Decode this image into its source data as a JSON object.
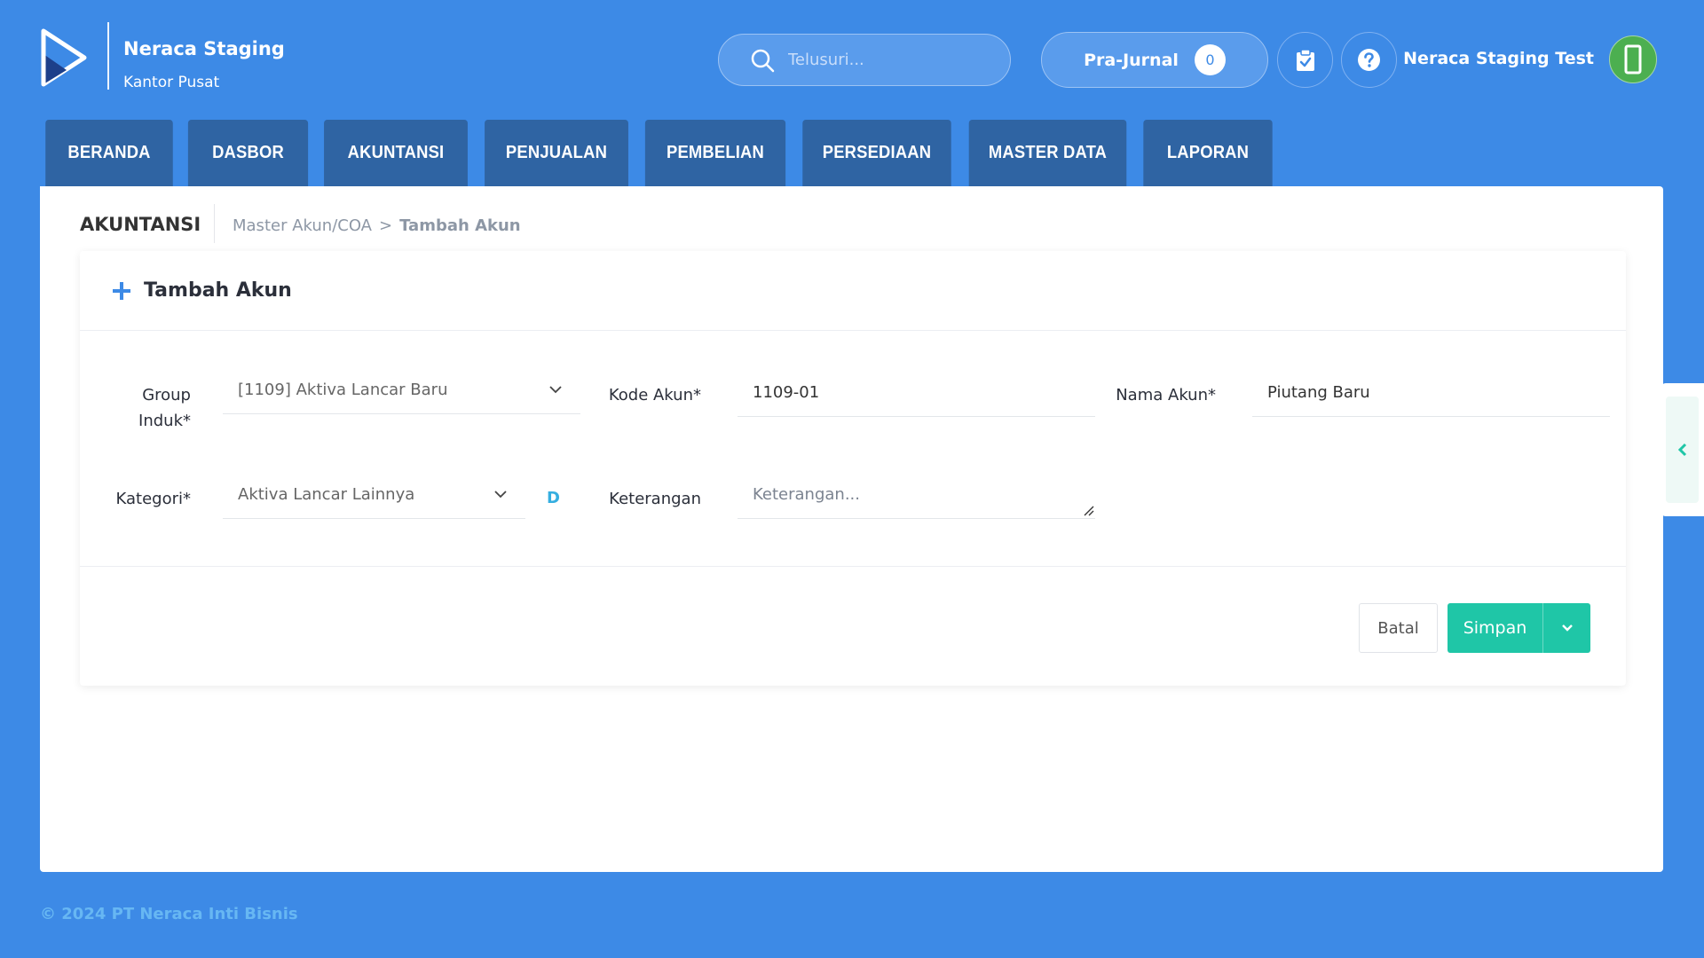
{
  "brand": {
    "name": "Neraca Staging",
    "office": "Kantor Pusat",
    "logo_icon": "play-logo-icon"
  },
  "header": {
    "search_placeholder": "Telusuri...",
    "prajurnal_label": "Pra-Jurnal",
    "prajurnal_count": "0",
    "user_name": "Neraca Staging Test",
    "icons": [
      "search-icon",
      "clipboard-check-icon",
      "help-icon",
      "phone-icon"
    ]
  },
  "nav": {
    "tabs": [
      "BERANDA",
      "DASBOR",
      "AKUNTANSI",
      "PENJUALAN",
      "PEMBELIAN",
      "PERSEDIAAN",
      "MASTER DATA",
      "LAPORAN"
    ]
  },
  "breadcrumb": {
    "section": "AKUNTANSI",
    "parent": "Master Akun/COA",
    "separator": ">",
    "current": "Tambah Akun"
  },
  "form": {
    "title": "Tambah Akun",
    "group_induk_label_1": "Group",
    "group_induk_label_2": "Induk*",
    "group_induk_value": "[1109] Aktiva Lancar Baru",
    "kode_akun_label": "Kode Akun*",
    "kode_akun_value": "1109-01",
    "nama_akun_label": "Nama Akun*",
    "nama_akun_value": "Piutang Baru",
    "kategori_label": "Kategori*",
    "kategori_value": "Aktiva Lancar Lainnya",
    "kategori_badge": "D",
    "keterangan_label": "Keterangan",
    "keterangan_placeholder": "Keterangan...",
    "batal_label": "Batal",
    "simpan_label": "Simpan"
  },
  "footer": {
    "copyright": "© 2024 PT Neraca Inti Bisnis"
  },
  "colors": {
    "background": "#3d8ae6",
    "nav_tab": "#2f64a3",
    "primary": "#1fc6a7",
    "accent": "#35aee0"
  }
}
